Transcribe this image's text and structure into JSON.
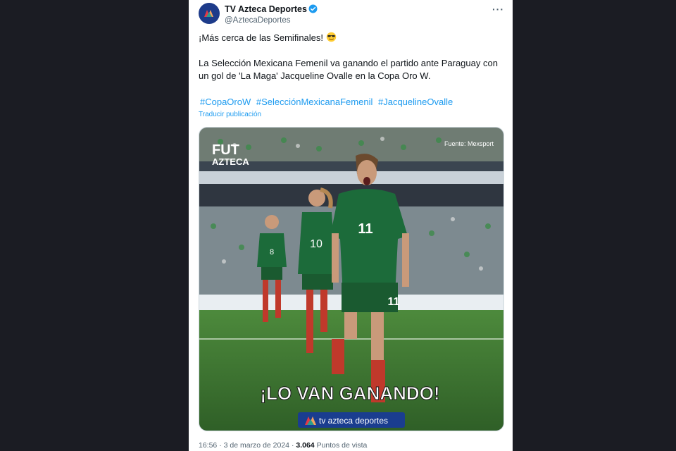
{
  "tweet": {
    "display_name": "TV Azteca Deportes",
    "handle": "@AztecaDeportes",
    "more_label": "···",
    "line1": "¡Más cerca de las Semifinales!",
    "line1_emoji": "smiling-face-with-sunglasses-icon",
    "paragraph2": "La Selección Mexicana Femenil va ganando el partido ante Paraguay con un gol de 'La Maga' Jacqueline Ovalle en la Copa Oro W.",
    "hashtags": [
      "#CopaOroW",
      "#SelecciónMexicanaFemenil",
      "#JacquelineOvalle"
    ],
    "translate_label": "Traducir publicación",
    "time": "16:56",
    "date": "3 de marzo de 2024",
    "views_count": "3.064",
    "views_label": "Puntos de vista"
  },
  "media": {
    "source_credit": "Fuente: Mexsport",
    "brand_top_line1": "FUT",
    "brand_top_line2": "AZTECA",
    "caption": "¡LO VAN GANANDO!",
    "brand_bottom": "tv azteca deportes",
    "player_main_number": "11",
    "player_mid_number": "10",
    "player_back_number": "8"
  },
  "colors": {
    "accent": "#1d9bf0",
    "jersey_green": "#1c6b3a",
    "pitch_green": "#3f7a34"
  }
}
